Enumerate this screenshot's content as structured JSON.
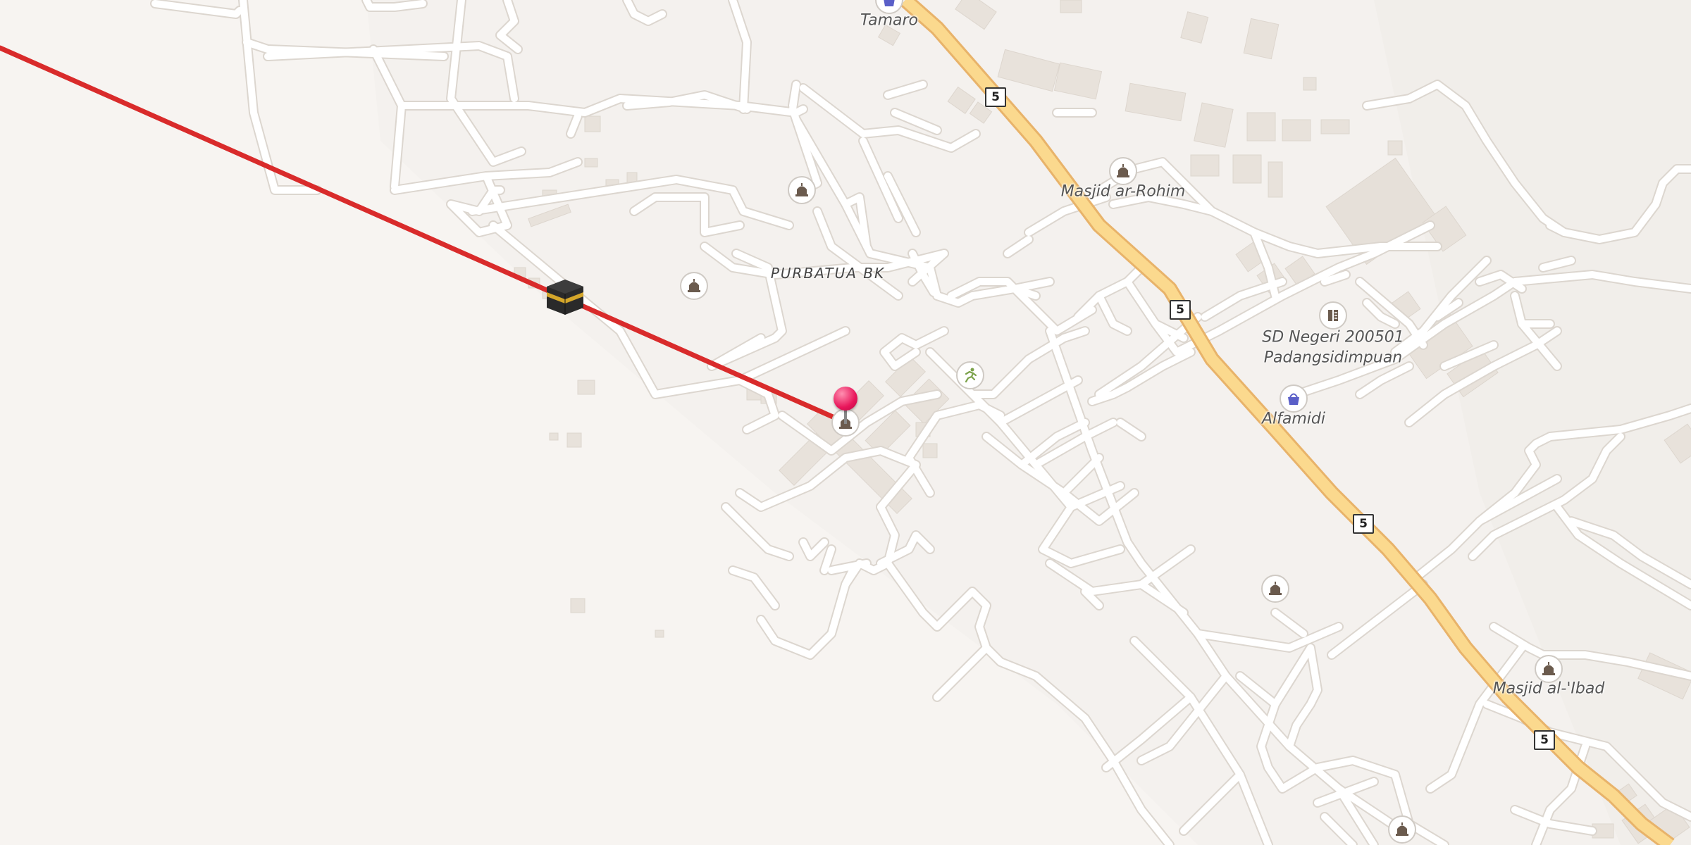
{
  "map": {
    "places": {
      "tamaro": "Tamaro",
      "masjid_ar_rohim": "Masjid ar-Rohim",
      "purbatua": "PURBATUA BK",
      "sd_negeri_line1": "SD Negeri 200501",
      "sd_negeri_line2": "Padangsidimpuan",
      "alfamidi": "Alfamidi",
      "masjid_al_ibad": "Masjid al-'Ibad"
    },
    "route_number": "5",
    "icons": [
      "mosque-icon",
      "shop-basket-icon",
      "school-icon",
      "sports-icon",
      "kaaba-icon",
      "location-pin-icon"
    ],
    "colors": {
      "background": "#f4f1ee",
      "road": "#ffffff",
      "road_casing": "#dcd6cf",
      "primary_road": "#fbd98e",
      "primary_road_casing": "#e8b36a",
      "qibla_line": "#d92b2b",
      "building": "#e7e1da",
      "pin": "#e8155a"
    }
  }
}
